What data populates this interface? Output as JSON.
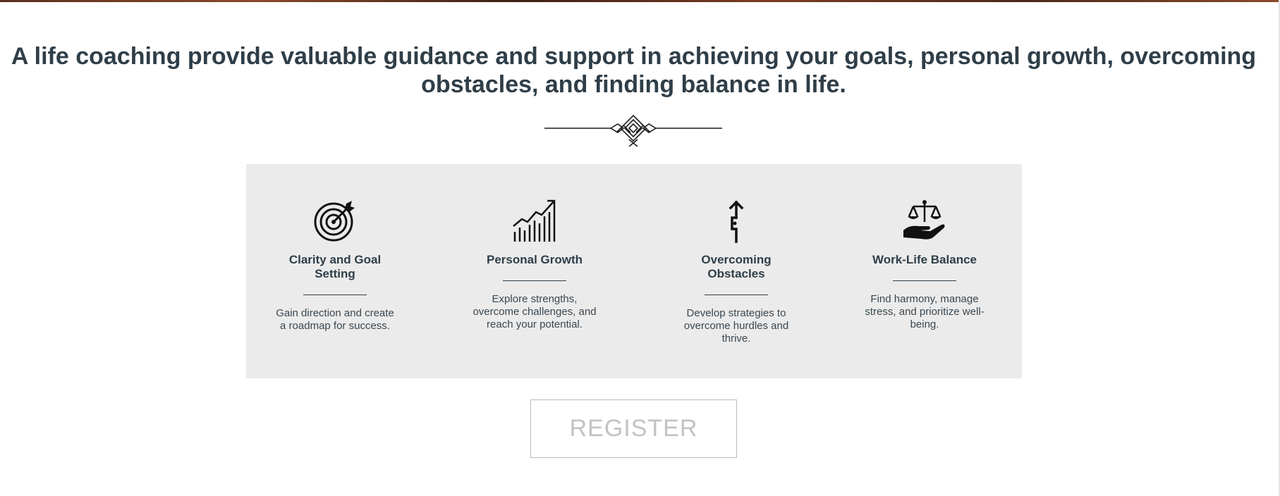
{
  "headline": "A life coaching provide valuable guidance and support in achieving your goals, personal growth, overcoming obstacles, and finding balance in life.",
  "colors": {
    "text": "#2f3e48",
    "panel_background": "#ebebeb",
    "button_text": "#c2c2c2",
    "button_border": "#b9b9b9"
  },
  "features": [
    {
      "icon": "target-icon",
      "title": "Clarity and Goal Setting",
      "description": "Gain direction and create a roadmap for success."
    },
    {
      "icon": "growth-chart-icon",
      "title": "Personal Growth",
      "description": "Explore strengths, overcome challenges, and reach your potential."
    },
    {
      "icon": "obstacle-path-icon",
      "title": "Overcoming Obstacles",
      "description": "Develop strategies to overcome hurdles and thrive."
    },
    {
      "icon": "balance-hand-icon",
      "title": "Work-Life Balance",
      "description": "Find harmony, manage stress, and prioritize well-being."
    }
  ],
  "register_label": "REGISTER"
}
